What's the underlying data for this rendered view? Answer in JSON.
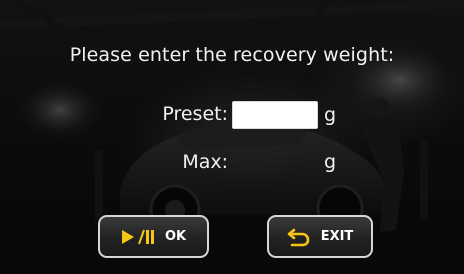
{
  "dialog": {
    "prompt": "Please enter the recovery weight:",
    "preset": {
      "label": "Preset:",
      "value": "",
      "unit": "g"
    },
    "max": {
      "label": "Max:",
      "value": "",
      "unit": "g"
    }
  },
  "buttons": {
    "ok": {
      "label": "OK",
      "icon": "play-pause-icon"
    },
    "exit": {
      "label": "EXIT",
      "icon": "return-arrow-icon"
    }
  },
  "colors": {
    "icon_yellow": "#f5c518",
    "text": "#f2f2f2",
    "button_border": "#d7d7d7"
  }
}
